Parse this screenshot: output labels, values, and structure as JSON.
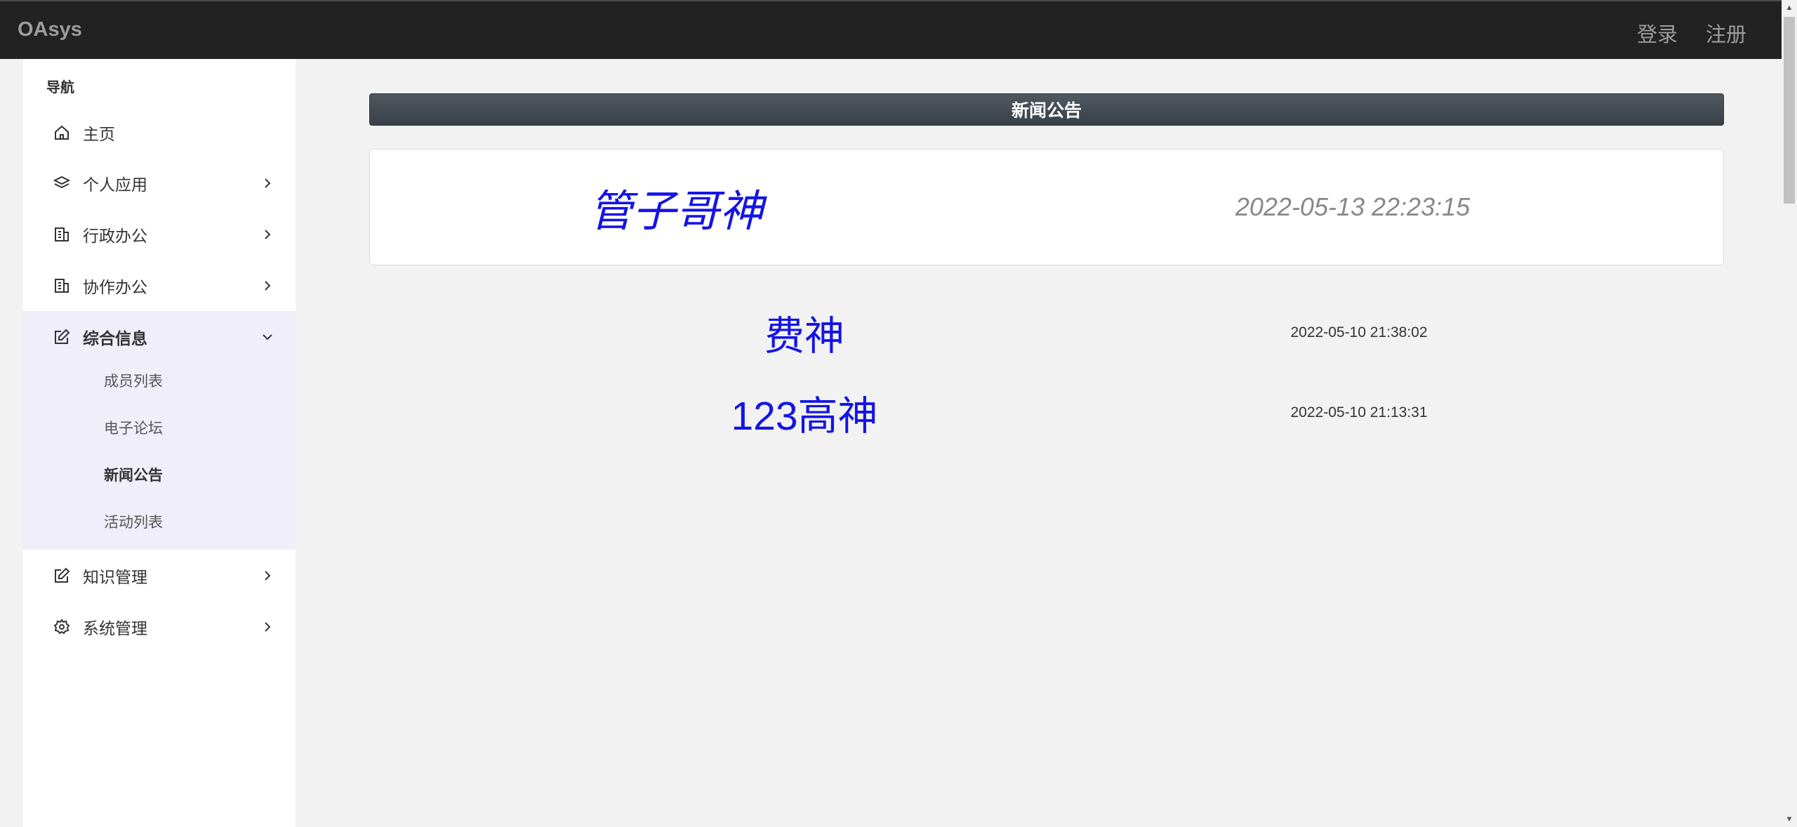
{
  "topbar": {
    "brand": "OAsys",
    "login": "登录",
    "register": "注册"
  },
  "sidebar": {
    "title": "导航",
    "items": [
      {
        "label": "主页",
        "icon": "home-icon"
      },
      {
        "label": "个人应用",
        "icon": "layers-icon"
      },
      {
        "label": "行政办公",
        "icon": "building-icon"
      },
      {
        "label": "协作办公",
        "icon": "building-icon"
      },
      {
        "label": "综合信息",
        "icon": "edit-icon"
      },
      {
        "label": "知识管理",
        "icon": "edit-icon"
      },
      {
        "label": "系统管理",
        "icon": "gear-icon"
      }
    ],
    "submenu": [
      {
        "label": "成员列表"
      },
      {
        "label": "电子论坛"
      },
      {
        "label": "新闻公告"
      },
      {
        "label": "活动列表"
      }
    ]
  },
  "main": {
    "header": "新闻公告",
    "featured": {
      "title": "管子哥神",
      "date": "2022-05-13 22:23:15"
    },
    "news": [
      {
        "title": "费神",
        "date": "2022-05-10 21:38:02"
      },
      {
        "title": "123高神",
        "date": "2022-05-10 21:13:31"
      }
    ]
  },
  "colors": {
    "topbar": "#222222",
    "link_blue": "#1414e6",
    "submenu_bg": "#efeef9",
    "page_bg": "#f2f2f2"
  }
}
